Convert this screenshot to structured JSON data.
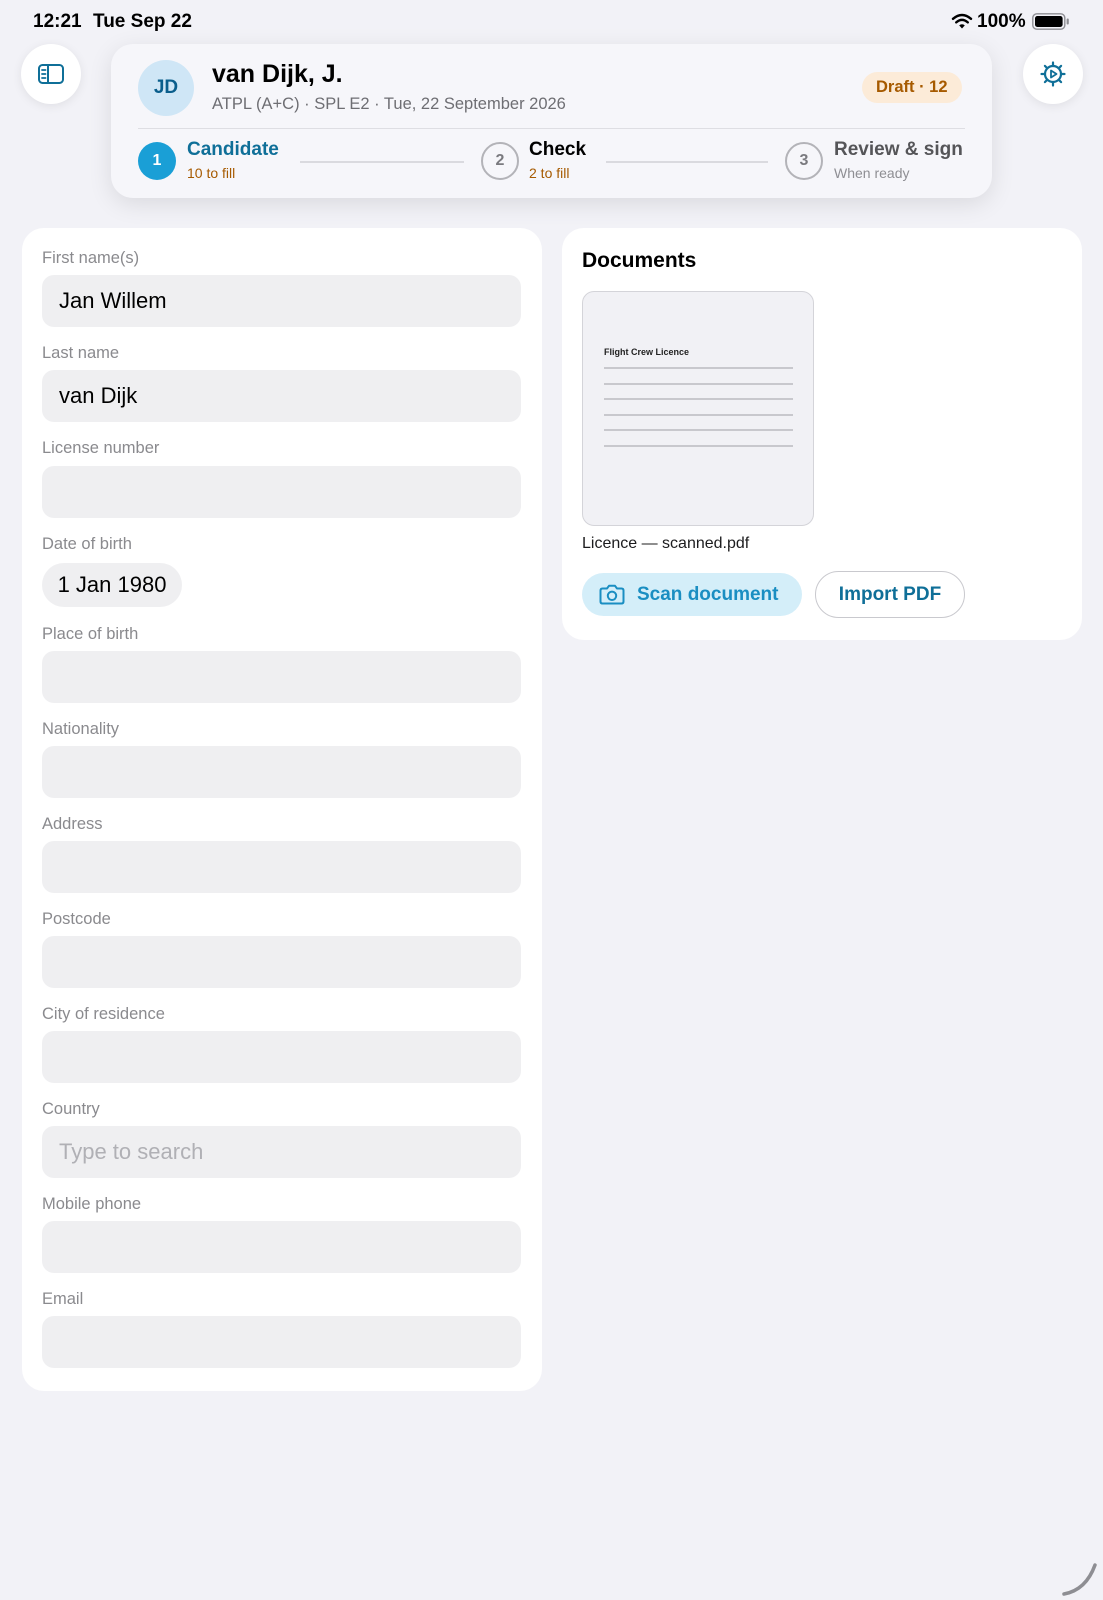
{
  "status_bar": {
    "time": "12:21",
    "date": "Tue Sep 22",
    "battery_percent": "100%",
    "wifi_icon": "wifi-icon",
    "battery_icon": "battery-icon"
  },
  "toolbar": {
    "sidebar_icon": "sidebar-icon",
    "settings_icon": "gear-icon"
  },
  "header": {
    "avatar_initials": "JD",
    "candidate_name": "van Dijk, J.",
    "subtitle": "ATPL (A+C) · SPL E2 · Tue, 22 September 2026",
    "badge": "Draft · 12",
    "steps": [
      {
        "number": "1",
        "title": "Candidate",
        "subtitle": "10 to fill",
        "state": "active"
      },
      {
        "number": "2",
        "title": "Check",
        "subtitle": "2 to fill",
        "state": "pending"
      },
      {
        "number": "3",
        "title": "Review & sign",
        "subtitle": "When ready",
        "state": "disabled"
      }
    ]
  },
  "form": {
    "fields": [
      {
        "label": "First name(s)",
        "value": "Jan Willem",
        "placeholder": ""
      },
      {
        "label": "Last name",
        "value": "van Dijk",
        "placeholder": ""
      },
      {
        "label": "License number",
        "value": "",
        "placeholder": ""
      },
      {
        "label": "Date of birth",
        "value": "1 Jan 1980",
        "placeholder": ""
      },
      {
        "label": "Place of birth",
        "value": "",
        "placeholder": ""
      },
      {
        "label": "Nationality",
        "value": "",
        "placeholder": ""
      },
      {
        "label": "Address",
        "value": "",
        "placeholder": ""
      },
      {
        "label": "Postcode",
        "value": "",
        "placeholder": ""
      },
      {
        "label": "City of residence",
        "value": "",
        "placeholder": ""
      },
      {
        "label": "Country",
        "value": "",
        "placeholder": "Type to search"
      },
      {
        "label": "Mobile phone",
        "value": "",
        "placeholder": ""
      },
      {
        "label": "Email",
        "value": "",
        "placeholder": ""
      }
    ]
  },
  "documents": {
    "title": "Documents",
    "thumbnail_title": "Flight Crew Licence",
    "file_name": "Licence — scanned.pdf",
    "scan_button": "Scan document",
    "scan_icon": "camera-icon",
    "import_button": "Import PDF"
  },
  "colors": {
    "accent": "#1a9fd6",
    "accent_dark": "#0f6f98",
    "warning_text": "#a65a00",
    "badge_bg": "#fcebd8",
    "background": "#f2f2f7"
  }
}
